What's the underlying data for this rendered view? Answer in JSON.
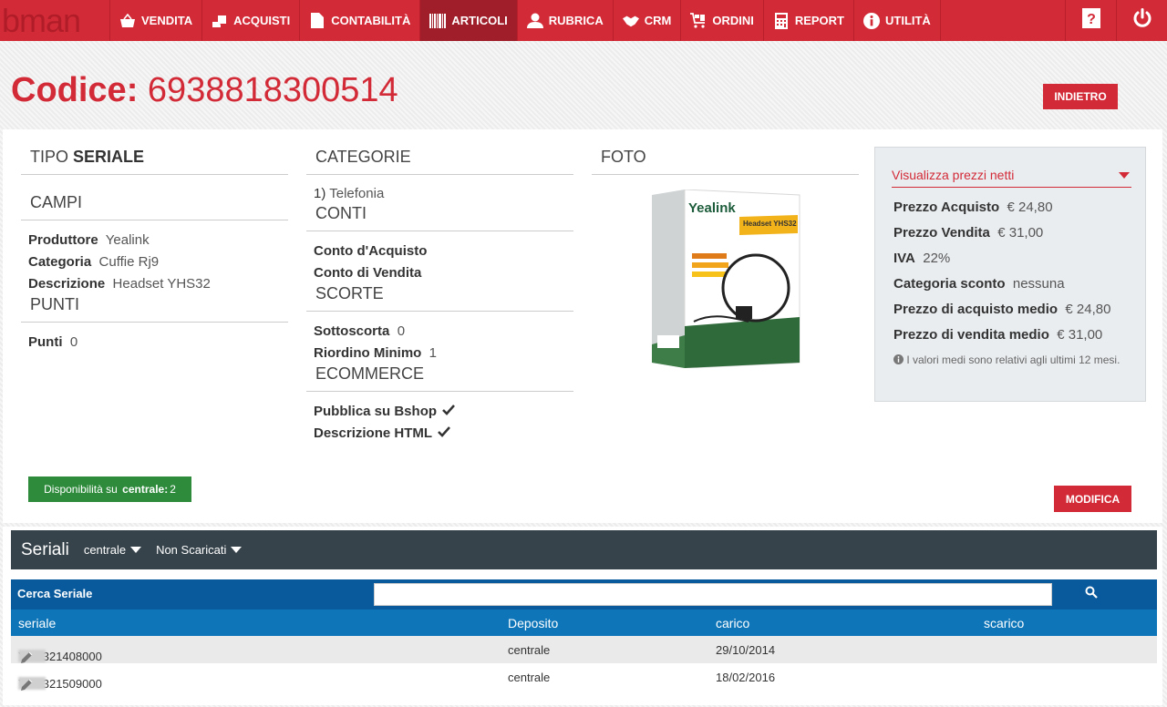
{
  "nav": {
    "logo": "bman",
    "items": [
      {
        "label": "VENDITA",
        "icon": "basket-icon"
      },
      {
        "label": "ACQUISTI",
        "icon": "hand-bag-icon"
      },
      {
        "label": "CONTABILITÀ",
        "icon": "document-icon"
      },
      {
        "label": "ARTICOLI",
        "icon": "barcode-icon"
      },
      {
        "label": "RUBRICA",
        "icon": "user-icon"
      },
      {
        "label": "CRM",
        "icon": "handshake-icon"
      },
      {
        "label": "ORDINI",
        "icon": "cart-icon"
      },
      {
        "label": "REPORT",
        "icon": "calculator-icon"
      },
      {
        "label": "UTILITÀ",
        "icon": "info-icon"
      }
    ],
    "active": "ARTICOLI"
  },
  "header": {
    "codice_label": "Codice:",
    "codice_value": "6938818300514",
    "back_label": "INDIETRO"
  },
  "tipo": {
    "prefix": "TIPO",
    "value": "SERIALE"
  },
  "campi": {
    "title": "CAMPI",
    "rows": [
      {
        "label": "Produttore",
        "value": "Yealink"
      },
      {
        "label": "Categoria",
        "value": "Cuffie Rj9"
      },
      {
        "label": "Descrizione",
        "value": "Headset YHS32"
      }
    ]
  },
  "punti": {
    "title": "PUNTI",
    "label": "Punti",
    "value": "0"
  },
  "categorie": {
    "title": "CATEGORIE",
    "items": [
      {
        "index": "1)",
        "name": "Telefonia"
      }
    ]
  },
  "conti": {
    "title": "CONTI",
    "acquisto": "Conto d'Acquisto",
    "vendita": "Conto di Vendita"
  },
  "scorte": {
    "title": "SCORTE",
    "rows": [
      {
        "label": "Sottoscorta",
        "value": "0"
      },
      {
        "label": "Riordino Minimo",
        "value": "1"
      }
    ]
  },
  "ecommerce": {
    "title": "ECOMMERCE",
    "pubblica": "Pubblica su Bshop",
    "descrizione": "Descrizione HTML"
  },
  "foto": {
    "title": "FOTO",
    "brand": "Yealink",
    "model": "Headset YHS32"
  },
  "prezzi": {
    "selector": "Visualizza prezzi netti",
    "rows": [
      {
        "label": "Prezzo Acquisto",
        "value": "€ 24,80"
      },
      {
        "label": "Prezzo Vendita",
        "value": "€ 31,00"
      },
      {
        "label": "IVA",
        "value": "22%"
      },
      {
        "label": "Categoria sconto",
        "value": "nessuna"
      },
      {
        "label": "Prezzo di acquisto medio",
        "value": "€ 24,80"
      },
      {
        "label": "Prezzo di vendita medio",
        "value": "€ 31,00"
      }
    ],
    "note": "I valori medi sono relativi agli ultimi 12 mesi."
  },
  "disponibilita": {
    "prefix": "Disponibilità su",
    "depot": "centrale:",
    "count": "2"
  },
  "modifica_label": "MODIFICA",
  "seriali": {
    "title": "Seriali",
    "filter_deposito": "centrale",
    "filter_stato": "Non Scaricati",
    "search_label": "Cerca Seriale",
    "search_value": "",
    "columns": [
      "seriale",
      "Deposito",
      "carico",
      "scarico"
    ],
    "rows": [
      {
        "seriale": "YHS321408000",
        "deposito": "centrale",
        "carico": "29/10/2014",
        "scarico": ""
      },
      {
        "seriale": "YHS321509000",
        "deposito": "centrale",
        "carico": "18/02/2016",
        "scarico": ""
      }
    ]
  },
  "colors": {
    "brand": "#d32a37",
    "dark_header": "#36434b",
    "search_bar": "#095a9c",
    "table_head": "#0e75b8",
    "success": "#2e8b3c"
  }
}
